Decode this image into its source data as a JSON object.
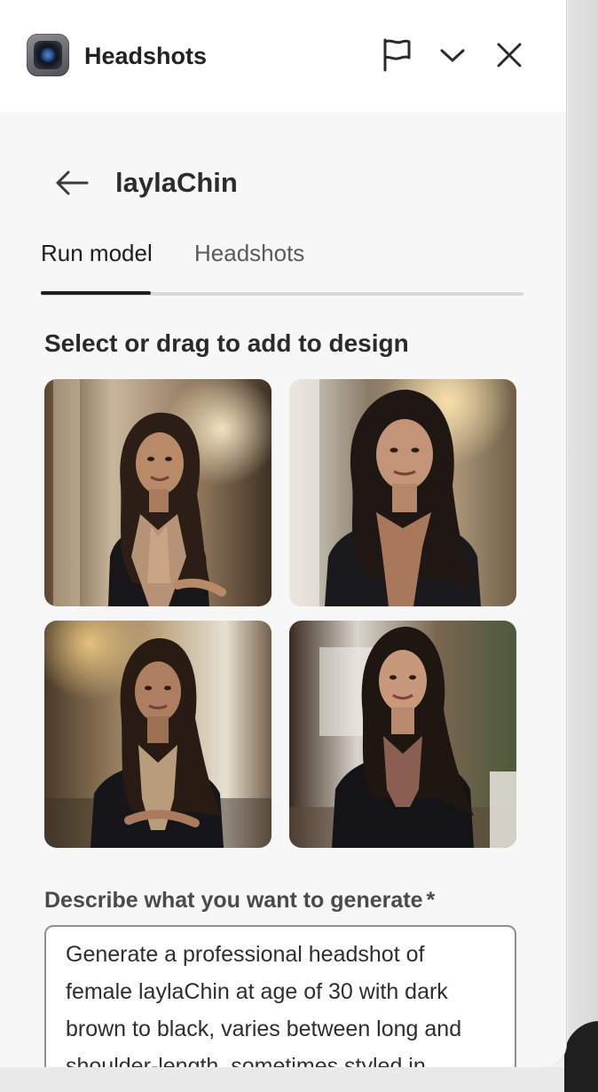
{
  "header": {
    "app_title": "Headshots",
    "app_icon": "camera-app-icon",
    "flag_icon": "flag-icon",
    "chevron_icon": "chevron-down-icon",
    "close_icon": "close-icon"
  },
  "page": {
    "back_icon": "arrow-left-icon",
    "title": "laylaChin"
  },
  "tabs": [
    {
      "label": "Run model",
      "active": true
    },
    {
      "label": "Headshots",
      "active": false
    }
  ],
  "gallery": {
    "heading": "Select or drag to add to design",
    "images": [
      {
        "name": "headshot-1"
      },
      {
        "name": "headshot-2"
      },
      {
        "name": "headshot-3"
      },
      {
        "name": "headshot-4"
      }
    ]
  },
  "prompt": {
    "label": "Describe what you want to generate",
    "required_mark": "*",
    "value": "Generate a professional headshot of female laylaChin at age of 30 with dark brown to black, varies between long and shoulder-length, sometimes styled in"
  },
  "colors": {
    "accent": "#1f1f1f",
    "panel_bg": "#f7f7f7",
    "header_bg": "#ffffff"
  }
}
